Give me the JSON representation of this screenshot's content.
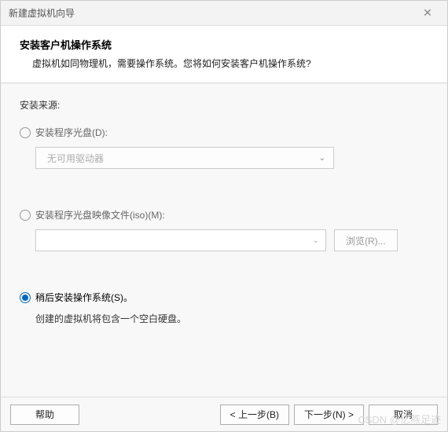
{
  "titlebar": {
    "title": "新建虚拟机向导"
  },
  "header": {
    "title": "安装客户机操作系统",
    "description": "虚拟机如同物理机，需要操作系统。您将如何安装客户机操作系统?"
  },
  "content": {
    "source_label": "安装来源:",
    "options": {
      "disc": {
        "label": "安装程序光盘(D):",
        "dropdown_value": "无可用驱动器",
        "selected": false
      },
      "iso": {
        "label": "安装程序光盘映像文件(iso)(M):",
        "path_value": "",
        "browse_label": "浏览(R)...",
        "selected": false
      },
      "later": {
        "label": "稍后安装操作系统(S)。",
        "hint": "创建的虚拟机将包含一个空白硬盘。",
        "selected": true
      }
    }
  },
  "footer": {
    "help": "帮助",
    "back": "< 上一步(B)",
    "next": "下一步(N) >",
    "cancel": "取消"
  },
  "watermark": "CSDN @亿燕足迹"
}
